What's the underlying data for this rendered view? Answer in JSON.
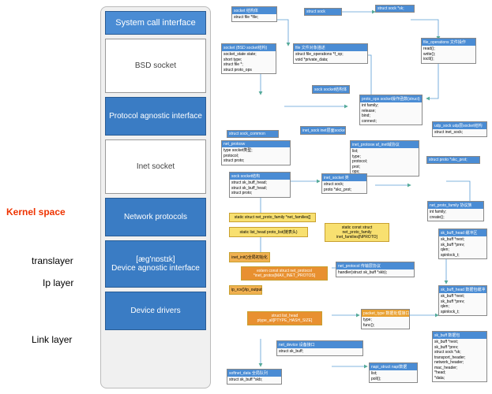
{
  "labels": {
    "kernel": "Kernel space",
    "trans": "translayer",
    "ip": "Ip layer",
    "link": "Link layer"
  },
  "stack": {
    "title": "System call interface",
    "items": [
      "BSD socket",
      "Protocol agnostic interface",
      "Inet socket",
      "Network protocols",
      "[æg'nɒstɪk]\nDevice agnostic interface",
      "Device drivers"
    ]
  },
  "boxes": {
    "b1": {
      "h": "socket 结构体",
      "b": "struct file *file;"
    },
    "b2": {
      "h": "struct sock *sk;",
      "b": ""
    },
    "b3": {
      "h": "socket (BSD socket结构)",
      "b": "socket_state state;\nshort type;\nstruct file *;\nstruct proto_ops"
    },
    "b4": {
      "h": "file 文件对象描述",
      "b": "struct file_operations *f_op;\nvoid *private_data;"
    },
    "b5": {
      "h": "file_operations 文件操作",
      "b": "read();\nwrite();\nioctl();"
    },
    "b6": {
      "h": "sock socket结构体",
      "b": "struct sock;"
    },
    "b7": {
      "h": "proto_ops socket操作函数(struct)",
      "b": "int family;\nrelease;\nbind;\nconnect;"
    },
    "b8": {
      "h": "udp_sock udp层socket结构",
      "b": "struct inet_sock;"
    },
    "b9": {
      "h": "inet_protosw af_inet域协议",
      "b": "list;\ntype;\nprotocol;\nprot;\nops;"
    },
    "b10": {
      "h": "struct sock",
      "b": ""
    },
    "b11": {
      "h": "struct proto *skc_prot;",
      "b": ""
    },
    "b12": {
      "h": "struct sock_common",
      "b": ""
    },
    "b13": {
      "h": "net_proto_family 协议族",
      "b": "int family;\ncreate();"
    },
    "b14": {
      "h": "sock socket结构",
      "b": "struct sk_buff_head;\nstruct sk_buff_head;\nstruct proto;"
    },
    "b15": {
      "h": "inet_socket 类",
      "b": "struct sock;\nproto *skc_prot;"
    },
    "b16": {
      "h": "sk_buff_head 缓冲区",
      "b": "sk_buff *next;\nsk_buff *prev;\nqlen;\nspinlock_t;"
    },
    "b17": {
      "h": "net_protocol 传输层协议",
      "b": "handler(struct sk_buff *skb);"
    },
    "b18": {
      "h": "sk_buff_head 数据包缓冲",
      "b": "sk_buff *next;\nsk_buff *prev;\nqlen;\nspinlock_t;"
    },
    "b19": {
      "h": "packet_type 数据处理接口",
      "b": "type;\nfunc();"
    },
    "b20": {
      "h": "net_device 设备接口",
      "b": "struct sk_buff;"
    },
    "b21": {
      "h": "sk_buff 数据包",
      "b": "sk_buff *next;\nsk_buff *prev;\nstruct sock *sk;\ntransport_header;\nnetwork_header;\nmac_header;\n*head;\n*data;"
    },
    "b22": {
      "h": "softnet_data 全局队列",
      "b": "struct sk_buff *skb;"
    },
    "b23": {
      "h": "napi_struct napi数据",
      "b": "list;\npoll();"
    },
    "b24": {
      "h": "net_protosw",
      "b": "type socket类型;\nprotocol;\nstruct proto;"
    },
    "b25": {
      "h": "inet_sock inet层面socket",
      "b": ""
    }
  },
  "yellow": {
    "y1": "static struct net_proto_family *net_families[]",
    "y2": "static list_head proto_list(链表头)",
    "y3": "static const struct\nnet_proto_family\ninet_families[NPROTO]",
    "y4": "inet_init()全局初始化",
    "y5": "ip_rcv()/ip_output",
    "y6": "extern const struct net_protocol\n*inet_protos[MAX_INET_PROTOS]",
    "y7": "struct list_head\nptype_all[PTYPE_HASH_SIZE]"
  }
}
